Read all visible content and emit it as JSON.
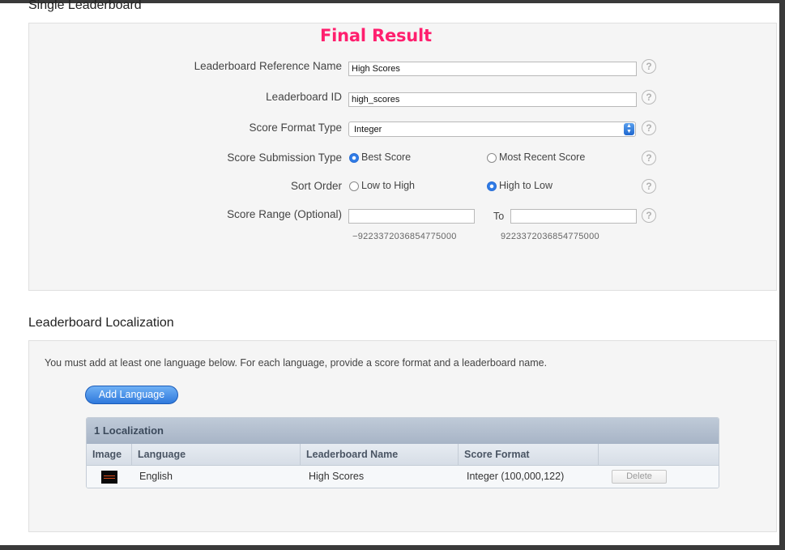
{
  "top_section": {
    "heading": "Single Leaderboard"
  },
  "annotation": {
    "final_result": "Final Result"
  },
  "form": {
    "reference_name": {
      "label": "Leaderboard Reference Name",
      "value": "High Scores"
    },
    "leaderboard_id": {
      "label": "Leaderboard ID",
      "value": "high_scores"
    },
    "score_format": {
      "label": "Score Format Type",
      "selected": "Integer"
    },
    "submission_type": {
      "label": "Score Submission Type",
      "options": [
        "Best Score",
        "Most Recent Score"
      ],
      "selected": "Best Score"
    },
    "sort_order": {
      "label": "Sort Order",
      "options": [
        "Low to High",
        "High to Low"
      ],
      "selected": "High to Low"
    },
    "score_range": {
      "label": "Score Range (Optional)",
      "to_label": "To",
      "min_note": "−9223372036854775000",
      "max_note": "9223372036854775000",
      "min_value": "",
      "max_value": ""
    },
    "help_glyph": "?"
  },
  "localization": {
    "heading": "Leaderboard Localization",
    "info": "You must add at least one language below. For each language, provide a score format and a leaderboard name.",
    "add_button": "Add Language",
    "table": {
      "title": "1 Localization",
      "columns": [
        "Image",
        "Language",
        "Leaderboard Name",
        "Score Format"
      ],
      "rows": [
        {
          "language": "English",
          "leaderboard_name": "High Scores",
          "score_format": "Integer (100,000,122)",
          "delete_label": "Delete"
        }
      ]
    }
  },
  "colors": {
    "accent_blue": "#2f79dc",
    "annotation_pink": "#ff1f6e",
    "panel_bg": "#f5f5f5"
  }
}
